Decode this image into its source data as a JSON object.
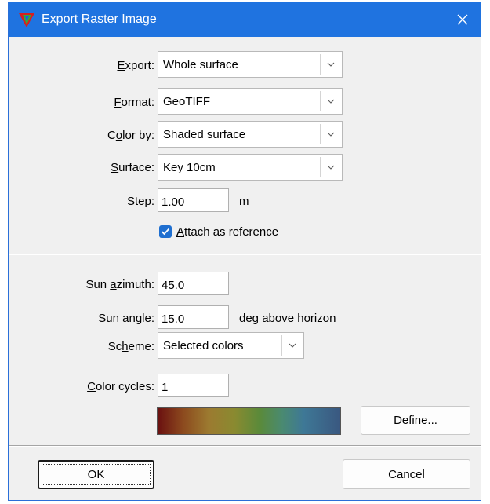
{
  "window": {
    "title": "Export Raster Image"
  },
  "form": {
    "export": {
      "label": "Export:",
      "mnemonic": "E",
      "rest": "xport:",
      "value": "Whole surface"
    },
    "format": {
      "label": "Format:",
      "mnemonic": "F",
      "rest": "ormat:",
      "value": "GeoTIFF"
    },
    "color_by": {
      "label": "Color by:",
      "pre": "C",
      "mnemonic": "o",
      "rest": "lor by:",
      "value": "Shaded surface"
    },
    "surface": {
      "label": "Surface:",
      "mnemonic": "S",
      "rest": "urface:",
      "value": "Key 10cm"
    },
    "step": {
      "label": "Step:",
      "pre": "St",
      "mnemonic": "e",
      "rest": "p:",
      "value": "1.00",
      "unit": "m"
    },
    "attach": {
      "label": "Attach as reference",
      "mnemonic": "A",
      "rest": "ttach as reference",
      "checked": true
    }
  },
  "shading": {
    "sun_azimuth": {
      "label": "Sun azimuth:",
      "pre": "Sun ",
      "mnemonic": "a",
      "rest": "zimuth:",
      "value": "45.0"
    },
    "sun_angle": {
      "label": "Sun angle:",
      "pre": "Sun a",
      "mnemonic": "n",
      "rest": "gle:",
      "value": "15.0",
      "unit": "deg above horizon"
    },
    "scheme": {
      "label": "Scheme:",
      "pre": "Sc",
      "mnemonic": "h",
      "rest": "eme:",
      "value": "Selected colors"
    },
    "color_cycles": {
      "label": "Color cycles:",
      "mnemonic": "C",
      "rest": "olor cycles:",
      "value": "1"
    },
    "define_button": {
      "label": "Define...",
      "mnemonic": "D",
      "rest": "efine..."
    }
  },
  "buttons": {
    "ok": "OK",
    "cancel": "Cancel"
  },
  "colors": {
    "titlebar": "#1f73e0",
    "accent": "#1f6fd0",
    "dialog_bg": "#f0f0f0"
  },
  "icons": {
    "app": "triangle-logo-icon",
    "close": "close-icon",
    "dropdown": "chevron-down-icon",
    "check": "checkmark-icon"
  }
}
